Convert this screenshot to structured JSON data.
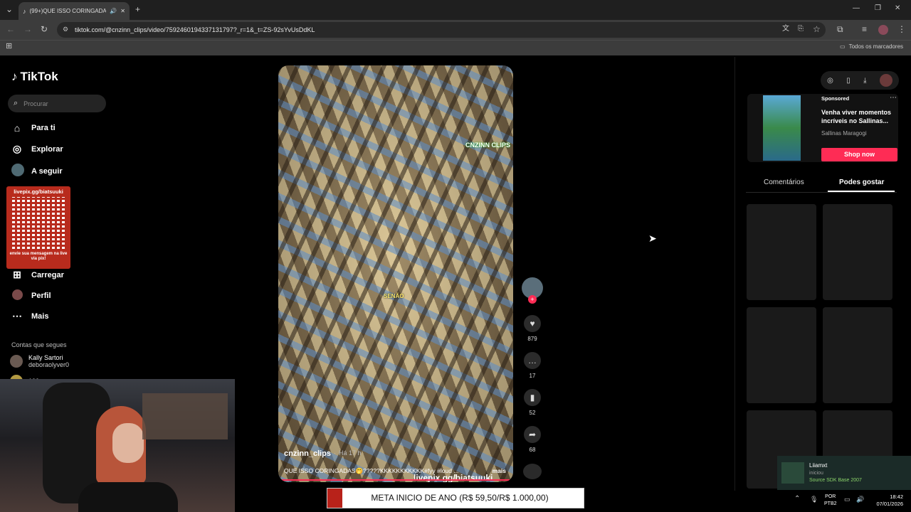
{
  "browser": {
    "tab_title": "(99+)QUE ISSO CORINGADA",
    "url": "tiktok.com/@cnzinn_clips/video/7592460194337131797?_r=1&_t=ZS-92sYvUsDdKL",
    "bookmarks_label": "Todos os marcadores"
  },
  "sidebar": {
    "logo": "TikTok",
    "search_placeholder": "Procurar",
    "nav": [
      {
        "label": "Para ti",
        "icon": "home-icon"
      },
      {
        "label": "Explorar",
        "icon": "compass-icon"
      },
      {
        "label": "A seguir",
        "icon": "avatar-icon"
      },
      {
        "label": "Carregar",
        "icon": "upload-icon"
      },
      {
        "label": "Perfil",
        "icon": "avatar-icon"
      },
      {
        "label": "Mais",
        "icon": "more-icon"
      }
    ],
    "following_title": "Contas que segues",
    "following": [
      {
        "name": "Kally Sartori",
        "handle": "deboraolyver0"
      },
      {
        "name": "100sono_gamer",
        "handle": ""
      }
    ]
  },
  "overlay_qr": {
    "top": "livepix.gg/biatsuuki",
    "bottom": "envie sua mensagem na live via pix!"
  },
  "video": {
    "watermark": "CNZINN CLIPS",
    "caption_word": "SENÃO",
    "author": "cnzinn_clips",
    "time": "Há 17 h",
    "description": "QUE ISSO CORINGADAS🤭?????KKKKKKKKKKK#fyy #loud ...",
    "more": "mais",
    "stream_link": "livepix.gg/biatsuuki"
  },
  "actions": {
    "likes": "879",
    "comments": "17",
    "saves": "52",
    "shares": "68"
  },
  "right": {
    "sponsored": "Sponsored",
    "ad_title": "Venha viver momentos incríveis no Sallinas...",
    "ad_brand": "Sallinas Maragogi",
    "shop_now": "Shop now",
    "tab_comments": "Comentários",
    "tab_like": "Podes gostar"
  },
  "stream_bar": {
    "text": "META INICIO DE ANO (R$ 59,50/R$ 1.000,00)",
    "accent": "#b8221a"
  },
  "notification": {
    "name": "Liiamxt",
    "line1": "iniciou",
    "line2": "Source SDK Base 2007"
  },
  "taskbar": {
    "lang1": "POR",
    "lang2": "PTB2",
    "time": "18:42",
    "date": "07/01/2026"
  },
  "colors": {
    "brand": "#fe2c55",
    "bg": "#000000"
  }
}
